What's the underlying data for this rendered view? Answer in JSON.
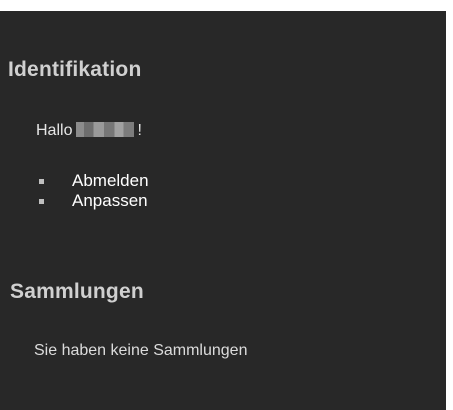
{
  "identification": {
    "title": "Identifikation",
    "greeting_prefix": "Hallo",
    "greeting_suffix": "!",
    "links": [
      {
        "label": "Abmelden"
      },
      {
        "label": "Anpassen"
      }
    ]
  },
  "collections": {
    "title": "Sammlungen",
    "empty_message": "Sie haben keine Sammlungen"
  },
  "colors": {
    "panel_background": "#282828",
    "page_background": "#ffffff",
    "title_text": "#d0d0d0",
    "link_text": "#ffffff"
  }
}
